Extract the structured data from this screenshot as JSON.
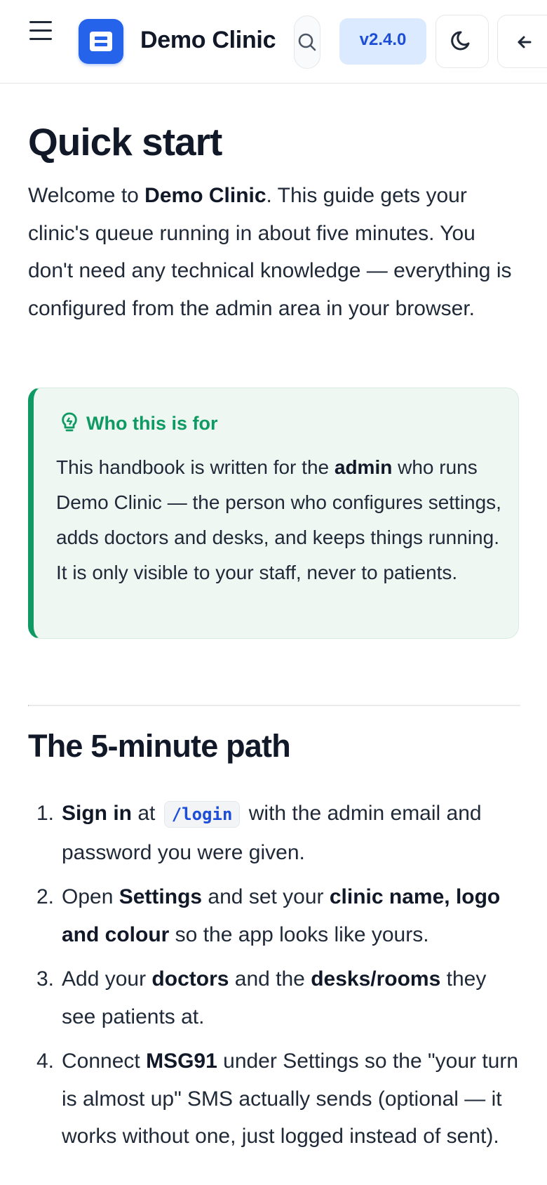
{
  "header": {
    "app_name": "Demo Clinic",
    "version": "v2.4.0",
    "icons": [
      "menu-icon",
      "clinic-logo-icon",
      "search-icon",
      "moon-icon",
      "arrow-left-icon"
    ]
  },
  "page": {
    "title": "Quick start",
    "intro": {
      "t1": "Welcome to ",
      "b1": "Demo Clinic",
      "t2": ". This guide gets your clinic's queue running in about five minutes. You don't need any technical knowledge — everything is configured from the admin area in your browser."
    },
    "callout": {
      "title": "Who this is for",
      "t1": "This handbook is written for the ",
      "b1": "admin",
      "t2": " who runs Demo Clinic — the person who configures settings, adds doctors and desks, and keeps things running. It is only visible to your staff, never to patients."
    }
  },
  "section": {
    "title": "The 5-minute path",
    "steps": [
      {
        "num": "1.",
        "b1": "Sign in",
        "t1": " at ",
        "code": "/login",
        "t2": " with the admin email and password you were given."
      },
      {
        "num": "2.",
        "t1": "Open ",
        "b1": "Settings",
        "t2": " and set your ",
        "b2": "clinic name, logo and colour",
        "t3": " so the app looks like yours."
      },
      {
        "num": "3.",
        "t1": "Add your ",
        "b1": "doctors",
        "t2": " and the ",
        "b2": "desks/rooms",
        "t3": " they see patients at."
      },
      {
        "num": "4.",
        "t1": "Connect ",
        "b1": "MSG91",
        "t2": " under Settings so the \"your turn is almost up\" SMS actually sends (optional — it works without one, just logged instead of sent)."
      }
    ]
  },
  "colors": {
    "brand": "#2563eb",
    "accent_green": "#0f9a63",
    "version_badge_bg": "#dbeafe",
    "callout_bg": "#eef7f2"
  }
}
